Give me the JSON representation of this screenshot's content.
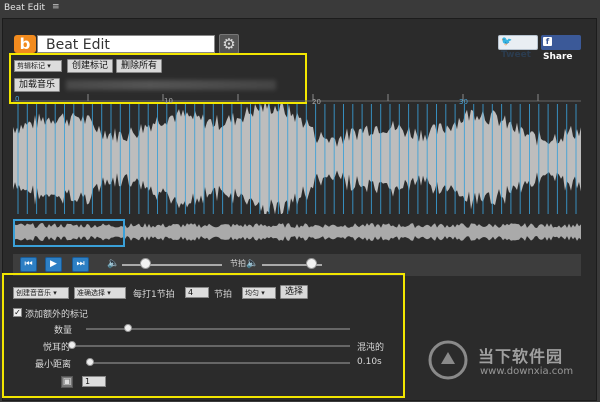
{
  "window": {
    "title": "Beat Edit",
    "menu_glyph": "≡"
  },
  "header": {
    "app_title": "Beat Edit",
    "logo_letter": "b",
    "tweet_label": "Tweet",
    "share_label": "Share",
    "brand_color": "#f28b1e"
  },
  "toolbar": {
    "mode_select": "剪辑标记",
    "create_marker": "创建标记",
    "delete_all": "删除所有",
    "load_music": "加载音乐"
  },
  "ruler": {
    "labels": [
      "0",
      "10",
      "20",
      "30"
    ]
  },
  "transport": {
    "prev_icon": "skip-back-icon",
    "play_icon": "play-icon",
    "next_icon": "skip-forward-icon",
    "volume_label": "节拍",
    "volume_level": 0.2,
    "beat_volume_level": 0.9
  },
  "settings": {
    "music_select": "创建音音乐",
    "beat_select": "准确选择",
    "every_label": "每打1节拍",
    "every_value": "4",
    "beat_label": "节拍",
    "even_select": "均匀",
    "choose_button": "选择",
    "add_extra_label": "添加额外的标记",
    "add_extra_checked": true,
    "count_label": "数量",
    "count_level": 0.15,
    "pleasant_label": "悦耳的",
    "chaotic_label": "混沌的",
    "pleasant_level": 0.0,
    "min_distance_label": "最小距离",
    "min_distance_value": "0.10s",
    "min_distance_level": 0.0,
    "seed_value": "1"
  },
  "watermark": {
    "text": "当下软件园",
    "url": "www.downxia.com"
  },
  "colors": {
    "accent_blue": "#3aa0d8",
    "highlight_yellow": "#f2e600",
    "waveform": "#bdbdbd"
  }
}
